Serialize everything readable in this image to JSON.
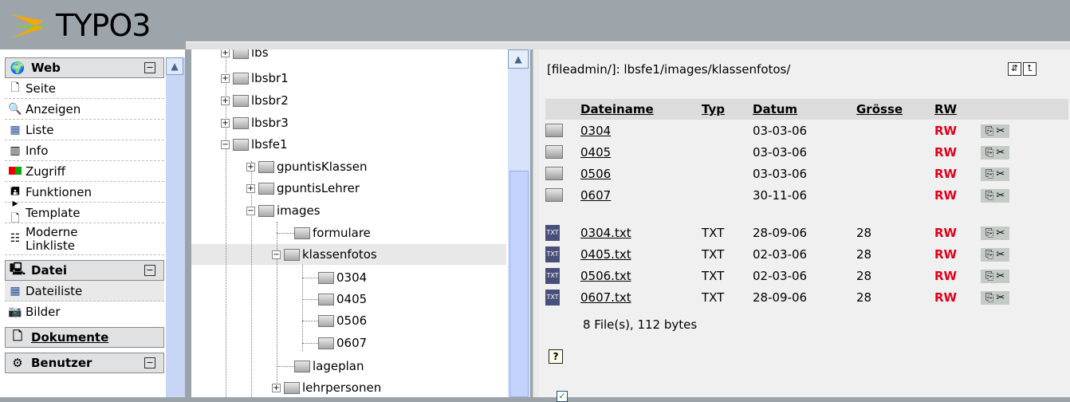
{
  "app": {
    "logo_text": "TYPO3"
  },
  "modmenu": {
    "groups": [
      {
        "title": "Web",
        "icon": "globe-icon",
        "items": [
          {
            "label": "Seite",
            "icon": "page-icon"
          },
          {
            "label": "Anzeigen",
            "icon": "magnifier-icon"
          },
          {
            "label": "Liste",
            "icon": "list-icon"
          },
          {
            "label": "Info",
            "icon": "info-icon"
          },
          {
            "label": "Zugriff",
            "icon": "access-icon"
          },
          {
            "label": "Funktionen",
            "icon": "functions-icon"
          },
          {
            "label": "Template",
            "icon": "template-icon"
          },
          {
            "label": "Moderne Linkliste",
            "icon": "linklist-icon"
          }
        ]
      },
      {
        "title": "Datei",
        "icon": "file-module-icon",
        "items": [
          {
            "label": "Dateiliste",
            "icon": "filelist-icon"
          },
          {
            "label": "Bilder",
            "icon": "camera-icon"
          }
        ]
      },
      {
        "title": "Dokumente",
        "icon": "documents-icon",
        "items": []
      },
      {
        "title": "Benutzer",
        "icon": "user-icon",
        "items": []
      }
    ]
  },
  "tree": {
    "nodes": [
      {
        "label": "lbs"
      },
      {
        "label": "lbsbr1"
      },
      {
        "label": "lbsbr2"
      },
      {
        "label": "lbsbr3"
      },
      {
        "label": "lbsfe1"
      },
      {
        "label": "gpuntisKlassen"
      },
      {
        "label": "gpuntisLehrer"
      },
      {
        "label": "images"
      },
      {
        "label": "formulare"
      },
      {
        "label": "klassenfotos"
      },
      {
        "label": "0304"
      },
      {
        "label": "0405"
      },
      {
        "label": "0506"
      },
      {
        "label": "0607"
      },
      {
        "label": "lageplan"
      },
      {
        "label": "lehrpersonen"
      }
    ]
  },
  "filelist": {
    "path": "[fileadmin/]: lbsfe1/images/klassenfotos/",
    "columns": {
      "name": "Dateiname",
      "type": "Typ",
      "date": "Datum",
      "size": "Grösse",
      "rw": "RW"
    },
    "folders": [
      {
        "name": "0304",
        "type": "",
        "date": "03-03-06",
        "size": "",
        "rw": "RW"
      },
      {
        "name": "0405",
        "type": "",
        "date": "03-03-06",
        "size": "",
        "rw": "RW"
      },
      {
        "name": "0506",
        "type": "",
        "date": "03-03-06",
        "size": "",
        "rw": "RW"
      },
      {
        "name": "0607",
        "type": "",
        "date": "30-11-06",
        "size": "",
        "rw": "RW"
      }
    ],
    "files": [
      {
        "name": "0304.txt",
        "type": "TXT",
        "date": "28-09-06",
        "size": "28",
        "rw": "RW"
      },
      {
        "name": "0405.txt",
        "type": "TXT",
        "date": "02-03-06",
        "size": "28",
        "rw": "RW"
      },
      {
        "name": "0506.txt",
        "type": "TXT",
        "date": "02-03-06",
        "size": "28",
        "rw": "RW"
      },
      {
        "name": "0607.txt",
        "type": "TXT",
        "date": "28-09-06",
        "size": "28",
        "rw": "RW"
      }
    ],
    "summary": "8 File(s), 112 bytes",
    "txt_icon_label": "TXT",
    "help_label": "?"
  },
  "colors": {
    "rw": "#e0001a",
    "header_bg": "#9da5ab",
    "scrollbar": "#c7d6f4"
  }
}
